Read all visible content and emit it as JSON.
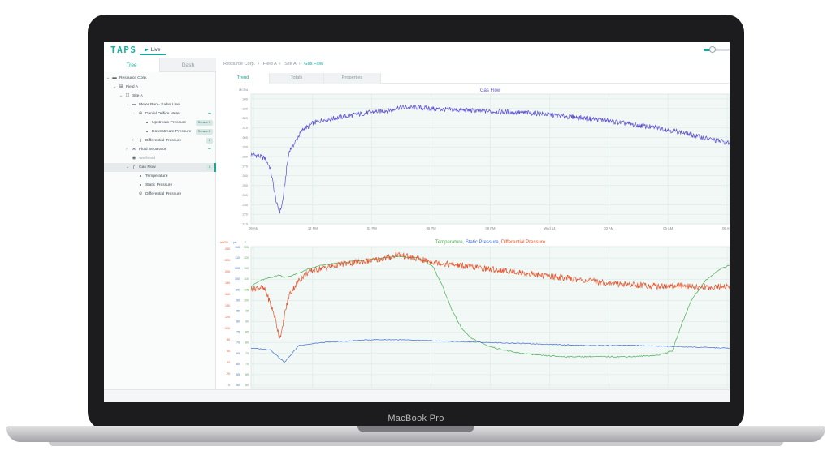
{
  "device": {
    "label": "MacBook Pro"
  },
  "app": {
    "logo": "TAPS",
    "live_tab": "Live",
    "live_icon": "play-icon",
    "zoom_slider_fraction": 0.35
  },
  "left_panel": {
    "tabs": [
      {
        "label": "Tree",
        "active": true
      },
      {
        "label": "Dash",
        "active": false
      }
    ],
    "tree": [
      {
        "indent": 0,
        "chevron": "v",
        "icon": "folder-icon",
        "label": "Resource Corp."
      },
      {
        "indent": 1,
        "chevron": "v",
        "icon": "field-icon",
        "label": "Field A"
      },
      {
        "indent": 2,
        "chevron": "v",
        "icon": "site-icon",
        "label": "Site A"
      },
      {
        "indent": 3,
        "chevron": "v",
        "icon": "folder-icon",
        "label": "Meter Run - Sales Line"
      },
      {
        "indent": 4,
        "chevron": "v",
        "icon": "orifice-meter-icon",
        "label": "Daniel Orifice Meter",
        "arrow": true
      },
      {
        "indent": 5,
        "chevron": "",
        "icon": "dot",
        "label": "Upstream Pressure",
        "badge": "Sensor 1"
      },
      {
        "indent": 5,
        "chevron": "",
        "icon": "dot",
        "label": "Downstream Pressure",
        "badge": "Sensor 2"
      },
      {
        "indent": 4,
        "chevron": ">",
        "icon": "function-icon",
        "label": "Differential Pressure",
        "badge": "2"
      },
      {
        "indent": 3,
        "chevron": ">",
        "icon": "separator-icon",
        "label": "Fluid Separator",
        "arrow": true
      },
      {
        "indent": 3,
        "chevron": "",
        "icon": "wellhead-icon",
        "label": "Wellhead",
        "dim": true
      },
      {
        "indent": 3,
        "chevron": "v",
        "icon": "function-icon",
        "label": "Gas Flow",
        "badge": "3",
        "selected": true
      },
      {
        "indent": 4,
        "chevron": "",
        "icon": "dot",
        "label": "Temperature"
      },
      {
        "indent": 4,
        "chevron": "",
        "icon": "dot",
        "label": "Static Pressure"
      },
      {
        "indent": 4,
        "chevron": "",
        "icon": "pressure-gauge-icon",
        "label": "Differential Pressure"
      }
    ]
  },
  "breadcrumb": [
    "Resource Corp.",
    "Field A",
    "Site A",
    "Gas Flow"
  ],
  "main_tabs": [
    {
      "label": "Trend",
      "active": true
    },
    {
      "label": "Totals",
      "active": false
    },
    {
      "label": "Properties",
      "active": false
    }
  ],
  "colors": {
    "gas_flow": "#5b4fd0",
    "temperature": "#4cae52",
    "static_pressure": "#3d6fd8",
    "differential_pressure": "#e5522a",
    "plot_bg": "#f1f8f6",
    "grid": "#dbe6e3",
    "accent": "#1aa79a"
  },
  "chart_data": [
    {
      "type": "line",
      "title": "Gas Flow",
      "ylabel": "MCF/d",
      "x_ticks": [
        "09 AM",
        "12 PM",
        "03 PM",
        "06 PM",
        "09 PM",
        "Wed 14",
        "03 AM",
        "06 AM",
        "09 AM"
      ],
      "y_ticks": [
        210,
        220,
        230,
        240,
        250,
        260,
        270,
        280,
        290,
        300,
        310,
        320,
        330,
        340
      ],
      "ylim": [
        210,
        345
      ],
      "series": [
        {
          "name": "Gas Flow",
          "x": [
            0,
            0.015,
            0.03,
            0.04,
            0.045,
            0.05,
            0.055,
            0.06,
            0.065,
            0.07,
            0.075,
            0.08,
            0.09,
            0.1,
            0.11,
            0.12,
            0.13,
            0.15,
            0.2,
            0.25,
            0.3,
            0.3,
            0.35,
            0.4,
            0.45,
            0.5,
            0.55,
            0.6,
            0.65,
            0.7,
            0.75,
            0.8,
            0.85,
            0.9,
            0.95,
            1.0
          ],
          "values": [
            282,
            281,
            278,
            268,
            255,
            240,
            228,
            223,
            230,
            248,
            270,
            286,
            293,
            302,
            309,
            311,
            315,
            318,
            322,
            326,
            329,
            331,
            331,
            329,
            328,
            327,
            326,
            325,
            322,
            320,
            317,
            313,
            310,
            305,
            299,
            294
          ]
        }
      ]
    },
    {
      "type": "line",
      "title_parts": [
        {
          "text": "Temperature",
          "series": "temperature"
        },
        {
          "text": ", ",
          "series": null
        },
        {
          "text": "Static Pressure",
          "series": "static_pressure"
        },
        {
          "text": ", ",
          "series": null
        },
        {
          "text": "Differential Pressure",
          "series": "differential_pressure"
        }
      ],
      "x_ticks": [
        "09 AM",
        "12 PM",
        "03 PM",
        "06 PM",
        "09 PM",
        "Wed 14",
        "03 AM",
        "06 AM",
        "09 AM"
      ],
      "left_axis": {
        "unit": "inH2O",
        "ticks": [
          240,
          220,
          200,
          180,
          160,
          140,
          120,
          100,
          80,
          60,
          40,
          20,
          0
        ]
      },
      "mid_axis": {
        "unit": "psi",
        "ticks": [
          115,
          110,
          105,
          100,
          95,
          90,
          85,
          80,
          75,
          70,
          65,
          60,
          55,
          50
        ]
      },
      "right_axis": {
        "unit": "F",
        "ticks": [
          125,
          120,
          115,
          110,
          105,
          100,
          95,
          90,
          85,
          80,
          75,
          70,
          65,
          60
        ]
      },
      "ylim_fraction": [
        0,
        1
      ],
      "series": [
        {
          "name": "Temperature",
          "x": [
            0,
            0.02,
            0.04,
            0.06,
            0.07,
            0.09,
            0.12,
            0.15,
            0.2,
            0.25,
            0.3,
            0.35,
            0.38,
            0.4,
            0.42,
            0.44,
            0.46,
            0.5,
            0.55,
            0.6,
            0.65,
            0.7,
            0.75,
            0.8,
            0.85,
            0.88,
            0.9,
            0.92,
            0.95,
            0.98,
            1.0
          ],
          "values": [
            0.72,
            0.76,
            0.78,
            0.8,
            0.78,
            0.8,
            0.84,
            0.87,
            0.89,
            0.91,
            0.93,
            0.92,
            0.86,
            0.72,
            0.55,
            0.42,
            0.35,
            0.29,
            0.25,
            0.23,
            0.22,
            0.22,
            0.22,
            0.22,
            0.23,
            0.26,
            0.45,
            0.62,
            0.76,
            0.84,
            0.87
          ]
        },
        {
          "name": "Static Pressure",
          "x": [
            0,
            0.04,
            0.05,
            0.06,
            0.07,
            0.08,
            0.1,
            0.15,
            0.2,
            0.25,
            0.3,
            0.4,
            0.5,
            0.6,
            0.7,
            0.8,
            0.9,
            1.0
          ],
          "values": [
            0.28,
            0.27,
            0.24,
            0.21,
            0.18,
            0.22,
            0.3,
            0.32,
            0.33,
            0.34,
            0.34,
            0.33,
            0.32,
            0.31,
            0.3,
            0.3,
            0.29,
            0.28
          ]
        },
        {
          "name": "Differential Pressure",
          "x": [
            0,
            0.02,
            0.03,
            0.04,
            0.05,
            0.055,
            0.06,
            0.065,
            0.07,
            0.08,
            0.1,
            0.12,
            0.15,
            0.2,
            0.25,
            0.3,
            0.3,
            0.35,
            0.4,
            0.45,
            0.5,
            0.55,
            0.6,
            0.65,
            0.7,
            0.75,
            0.8,
            0.85,
            0.9,
            0.95,
            1.0
          ],
          "values": [
            0.7,
            0.71,
            0.69,
            0.6,
            0.5,
            0.42,
            0.36,
            0.4,
            0.52,
            0.66,
            0.76,
            0.82,
            0.85,
            0.88,
            0.9,
            0.93,
            0.95,
            0.91,
            0.88,
            0.86,
            0.84,
            0.82,
            0.8,
            0.78,
            0.76,
            0.74,
            0.73,
            0.72,
            0.72,
            0.71,
            0.72
          ]
        }
      ]
    }
  ]
}
